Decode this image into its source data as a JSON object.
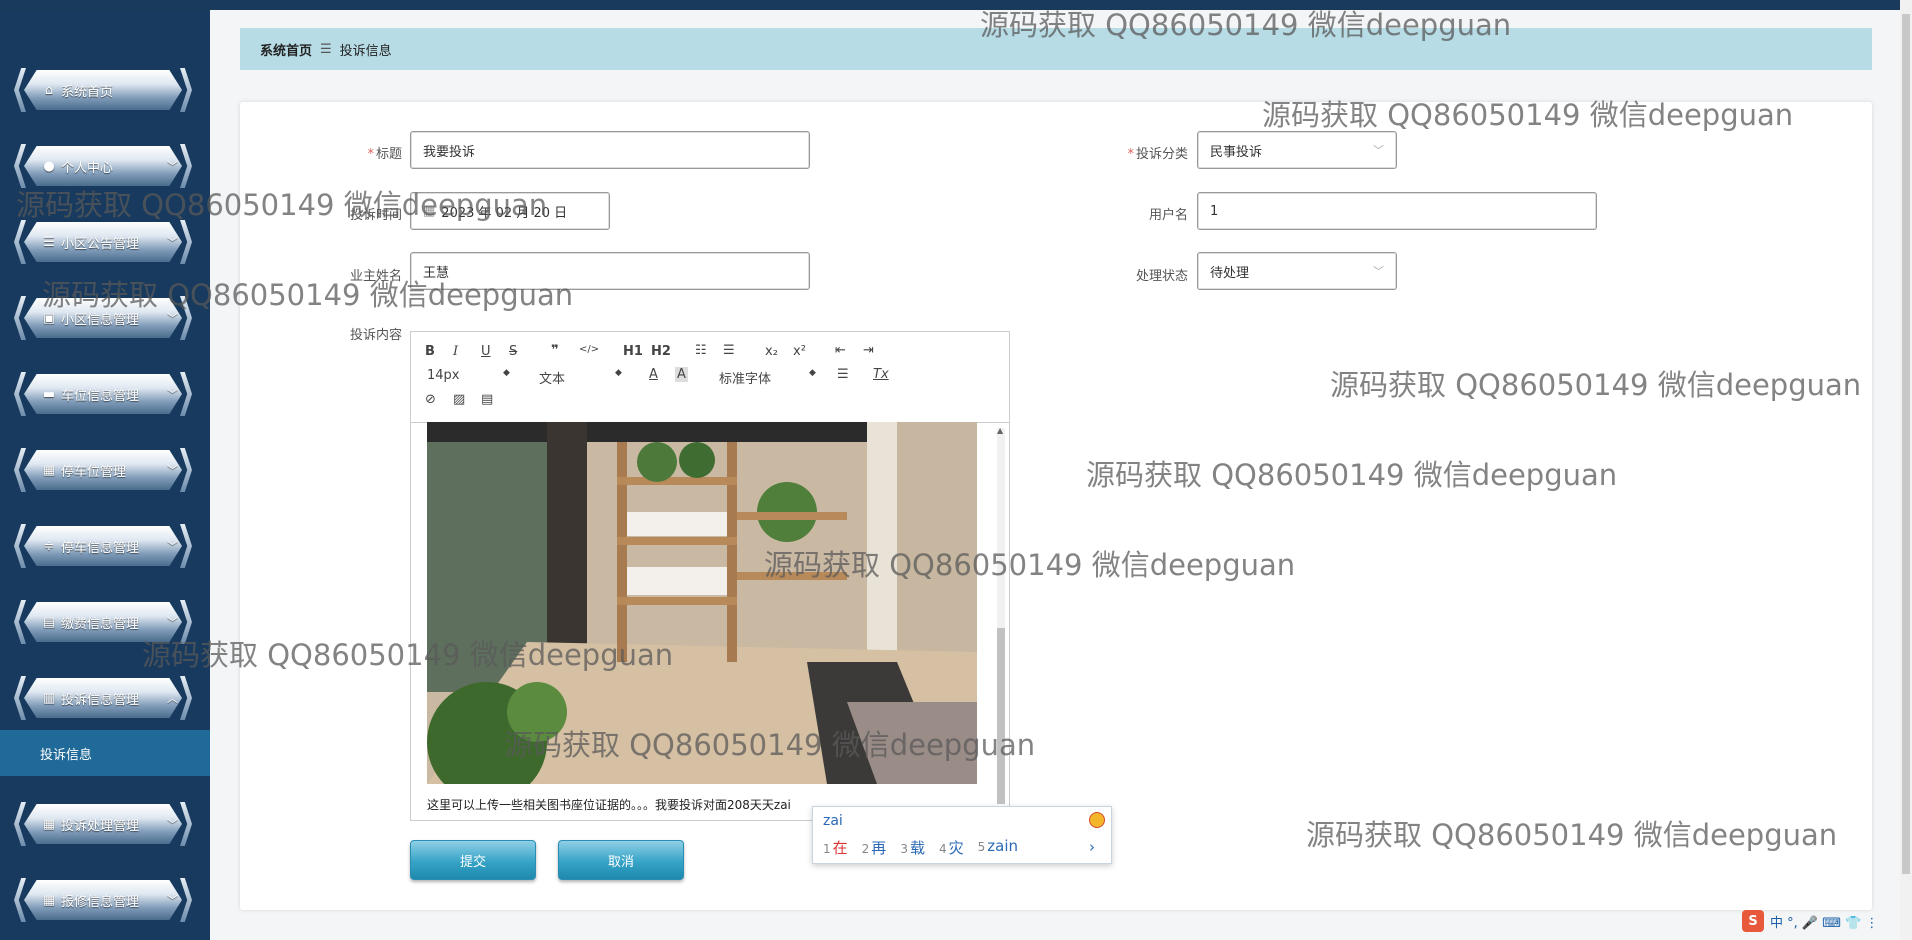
{
  "sidebar": {
    "items": [
      {
        "label": "系统首页",
        "icon": "home-icon",
        "expandable": false
      },
      {
        "label": "个人中心",
        "icon": "user-icon",
        "expandable": true
      },
      {
        "label": "小区公告管理",
        "icon": "list-icon",
        "expandable": true
      },
      {
        "label": "小区信息管理",
        "icon": "briefcase-icon",
        "expandable": true
      },
      {
        "label": "车位信息管理",
        "icon": "wallet-icon",
        "expandable": true
      },
      {
        "label": "停车位管理",
        "icon": "grid-icon",
        "expandable": true
      },
      {
        "label": "停车信息管理",
        "icon": "sliders-icon",
        "expandable": true
      },
      {
        "label": "缴费信息管理",
        "icon": "receipt-icon",
        "expandable": true
      },
      {
        "label": "投诉信息管理",
        "icon": "clipboard-icon",
        "expandable": true,
        "expanded": true
      },
      {
        "label": "投诉处理管理",
        "icon": "grid-icon",
        "expandable": true
      },
      {
        "label": "报修信息管理",
        "icon": "grid-icon",
        "expandable": true
      }
    ],
    "active_sub": "投诉信息"
  },
  "breadcrumb": {
    "home": "系统首页",
    "separator": "☰",
    "current": "投诉信息"
  },
  "form": {
    "title": {
      "label": "标题",
      "value": "我要投诉"
    },
    "category": {
      "label": "投诉分类",
      "value": "民事投诉"
    },
    "time": {
      "label": "投诉时间",
      "value": "2023 年 02 月 20 日"
    },
    "username": {
      "label": "用户名",
      "value": "1"
    },
    "owner": {
      "label": "业主姓名",
      "value": "王慧"
    },
    "status": {
      "label": "处理状态",
      "value": "待处理"
    },
    "content": {
      "label": "投诉内容"
    }
  },
  "editor": {
    "toolbar": {
      "bold": "B",
      "italic": "I",
      "underline": "U",
      "strike": "S",
      "quote": "❞",
      "code": "</>",
      "h1": "H1",
      "h2": "H2",
      "ordered": "☷",
      "bullet": "☰",
      "sub": "x₂",
      "sup": "x²",
      "outdent": "⇤",
      "indent": "⇥",
      "size": "14px",
      "text_type": "文本",
      "font": "标准字体",
      "clear": "Tx"
    },
    "text": "这里可以上传一些相关图书座位证据的。。。我要投诉对面208天天zai"
  },
  "buttons": {
    "submit": "提交",
    "cancel": "取消"
  },
  "ime": {
    "composition": "zai",
    "candidates": [
      {
        "n": "1",
        "t": "在"
      },
      {
        "n": "2",
        "t": "再"
      },
      {
        "n": "3",
        "t": "载"
      },
      {
        "n": "4",
        "t": "灾"
      },
      {
        "n": "5",
        "t": "zain"
      }
    ],
    "next": "›"
  },
  "watermark": "源码获取 QQ86050149 微信deepguan",
  "tray": {
    "s": "S",
    "items": "中 °, 🎤 ⌨ 👕 ⋮"
  }
}
